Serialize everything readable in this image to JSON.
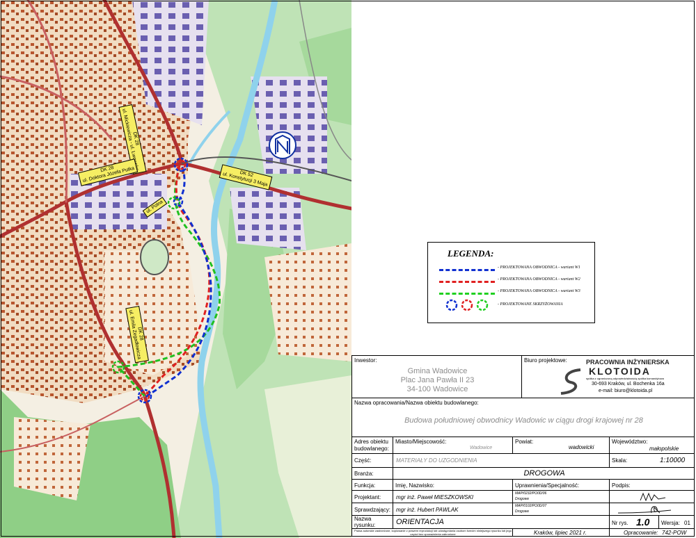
{
  "map": {
    "road_labels": [
      {
        "id": "dk28-north",
        "lines": [
          "DK 28",
          "ul. Mickiewicza - ul. Lwowska"
        ]
      },
      {
        "id": "dk28-west",
        "lines": [
          "DK 28",
          "ul. Doktora Józefa Putka"
        ]
      },
      {
        "id": "dk52",
        "lines": [
          "DK 52",
          "ul. Konstytucji 3 Maja"
        ]
      },
      {
        "id": "dk28-south",
        "lines": [
          "DK 28",
          "ul. Emila Zegadłowicza"
        ]
      },
      {
        "id": "small",
        "lines": [
          "ul. Polna"
        ]
      }
    ],
    "colors": {
      "variant_w1": "#1030d0",
      "variant_w2": "#e02020",
      "variant_w3": "#20d020",
      "road": "#d04040",
      "river": "#9ad8ee",
      "forest": "#a7d8a0",
      "built": "#e9c7a0"
    }
  },
  "legend": {
    "title": "LEGENDA:",
    "items": [
      {
        "label": "- PROJEKTOWANA OBWODNICA - wariant W1",
        "color": "#1030d0",
        "kind": "line"
      },
      {
        "label": "- PROJEKTOWANA OBWODNICA - wariant W2",
        "color": "#e02020",
        "kind": "line"
      },
      {
        "label": "- PROJEKTOWANA OBWODNICA - wariant W3",
        "color": "#20d020",
        "kind": "line"
      },
      {
        "label": "- PROJEKTOWANE SKRZYŻOWANIA",
        "color": "",
        "kind": "circles"
      }
    ]
  },
  "title_block": {
    "investor_label": "Inwestor:",
    "investor_lines": [
      "Gmina Wadowice",
      "Plac Jana Pawła II 23",
      "34-100 Wadowice"
    ],
    "office_label": "Biuro projektowe:",
    "company_top": "PRACOWNIA INŻYNIERSKA",
    "company_name": "KLOTOIDA",
    "company_sub": "spółka z ograniczoną odpowiedzialnością spółka komandytowa",
    "company_addr": "30-693 Kraków, ul. Bochenka 16a",
    "company_email": "e-mail: biuro@klotoida.pl",
    "object_label": "Nazwa opracowania/Nazwa obiektu budowlanego:",
    "object_name": "Budowa południowej obwodnicy Wadowic w ciągu drogi krajowej nr 28",
    "addr_label": "Adres obiektu budowlanego:",
    "city_label": "Miasto/Miejscowość:",
    "city_value": "Wadowice",
    "county_label": "Powiat:",
    "county_value": "wadowicki",
    "voiv_label": "Województwo:",
    "voiv_value": "małopolskie",
    "part_label": "Część:",
    "part_value": "MATERIAŁY DO UZGODNIENIA",
    "scale_label": "Skala:",
    "scale_value": "1:10000",
    "branch_label": "Branża:",
    "branch_value": "DROGOWA",
    "func_label": "Funkcja:",
    "name_label": "Imię, Nazwisko:",
    "perm_label": "Uprawnienia/Specjalność:",
    "sign_label": "Podpis:",
    "designer_label": "Projektant:",
    "designer_name": "mgr inż. Paweł MIESZKOWSKI",
    "designer_perm": "MAP/0232/PO0D/06",
    "designer_spec": "Drogowe",
    "checker_label": "Sprawdzający:",
    "checker_name": "mgr inż. Hubert PAWLAK",
    "checker_perm": "MAP/0102/PO0D/07",
    "checker_spec": "Drogowe",
    "drawing_label": "Nazwa rysunku:",
    "drawing_name": "ORIENTACJA",
    "nr_label": "Nr rys.",
    "nr_value": "1.0",
    "version_label": "Wersja:",
    "version_value": "01",
    "copyright": "Prawa autorskie zastrzeżone, kopiowanie z prawem reprodukcji lub udostępniania osobom trzecim niniejszego rysunku lub jego części bez upoważnienia zabronione",
    "place_date": "Kraków, lipiec 2021 r.",
    "elab_label": "Opracowanie:",
    "elab_value": "742-POW"
  }
}
